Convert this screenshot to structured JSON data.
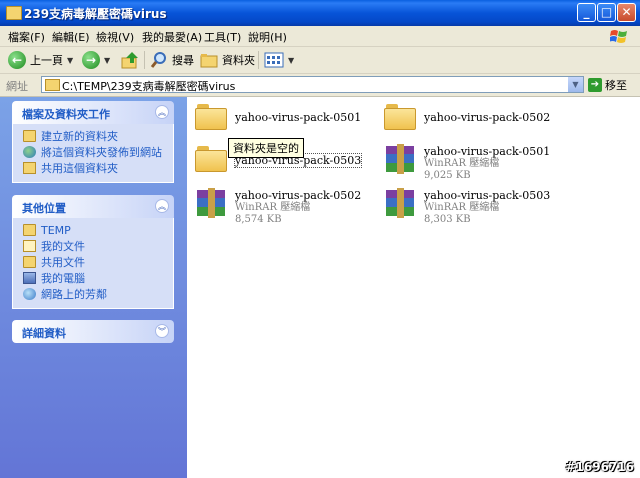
{
  "window": {
    "title": "239支病毒解壓密碼virus"
  },
  "menu": [
    "檔案(F)",
    "編輯(E)",
    "檢視(V)",
    "我的最愛(A)",
    "工具(T)",
    "說明(H)"
  ],
  "toolbar": {
    "back": "上一頁",
    "search": "搜尋",
    "folders": "資料夾"
  },
  "address": {
    "label": "網址",
    "path": "C:\\TEMP\\239支病毒解壓密碼virus",
    "go": "移至"
  },
  "panels": {
    "tasks": {
      "title": "檔案及資料夾工作",
      "items": [
        "建立新的資料夾",
        "將這個資料夾發佈到網站",
        "共用這個資料夾"
      ]
    },
    "places": {
      "title": "其他位置",
      "items": [
        "TEMP",
        "我的文件",
        "共用文件",
        "我的電腦",
        "網路上的芳鄰"
      ]
    },
    "details": {
      "title": "詳細資料"
    }
  },
  "files": [
    {
      "name": "yahoo-virus-pack-0501",
      "type": "folder"
    },
    {
      "name": "yahoo-virus-pack-0502",
      "type": "folder"
    },
    {
      "name": "yahoo-virus-pack-0503",
      "type": "folder"
    },
    {
      "name": "yahoo-virus-pack-0501",
      "type": "rar",
      "kind": "WinRAR 壓縮檔",
      "size": "9,025 KB"
    },
    {
      "name": "yahoo-virus-pack-0502",
      "type": "rar",
      "kind": "WinRAR 壓縮檔",
      "size": "8,574 KB"
    },
    {
      "name": "yahoo-virus-pack-0503",
      "type": "rar",
      "kind": "WinRAR 壓縮檔",
      "size": "8,303 KB"
    }
  ],
  "tooltip": "資料夾是空的",
  "watermark": "#1696716"
}
